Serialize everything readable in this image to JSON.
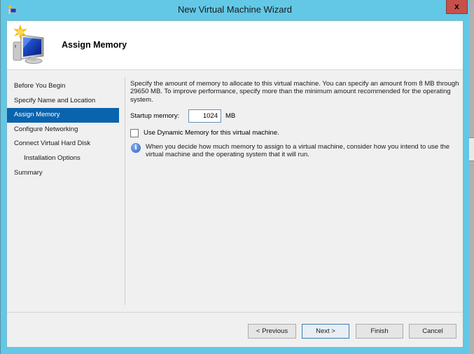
{
  "window": {
    "title": "New Virtual Machine Wizard",
    "close_label": "x",
    "frame_color": "#62c8e6",
    "close_color": "#c7504a"
  },
  "header": {
    "title": "Assign Memory",
    "icon": "virtual-machine-monitor-icon"
  },
  "nav": {
    "items": [
      {
        "label": "Before You Begin",
        "active": false
      },
      {
        "label": "Specify Name and Location",
        "active": false
      },
      {
        "label": "Assign Memory",
        "active": true
      },
      {
        "label": "Configure Networking",
        "active": false
      },
      {
        "label": "Connect Virtual Hard Disk",
        "active": false
      },
      {
        "label": "Installation Options",
        "active": false,
        "sub": true
      },
      {
        "label": "Summary",
        "active": false
      }
    ],
    "active_color": "#0a64ad"
  },
  "content": {
    "description": "Specify the amount of memory to allocate to this virtual machine. You can specify an amount from 8 MB through 29650 MB. To improve performance, specify more than the minimum amount recommended for the operating system.",
    "startup_memory_label": "Startup memory:",
    "startup_memory_value": "1024",
    "startup_memory_unit": "MB",
    "dynamic_memory_label": "Use Dynamic Memory for this virtual machine.",
    "dynamic_memory_checked": false,
    "info_icon": "information-icon",
    "info_text": "When you decide how much memory to assign to a virtual machine, consider how you intend to use the virtual machine and the operating system that it will run."
  },
  "buttons": {
    "previous": "< Previous",
    "next": "Next >",
    "finish": "Finish",
    "cancel": "Cancel"
  }
}
